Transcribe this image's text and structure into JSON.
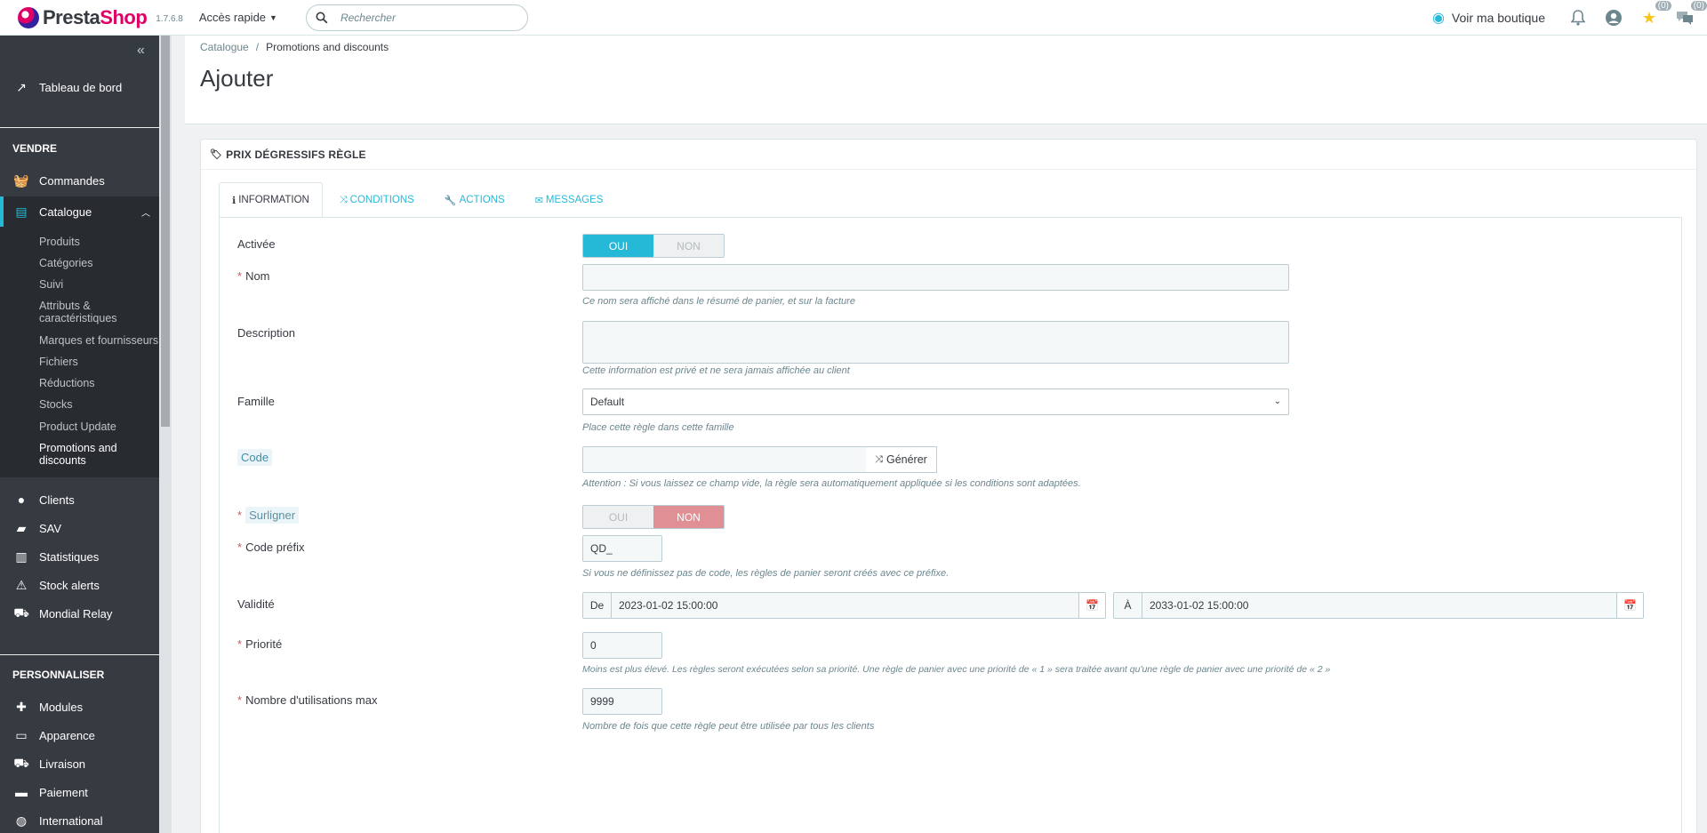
{
  "header": {
    "logo_text_a": "Presta",
    "logo_text_b": "Shop",
    "version": "1.7.6.8",
    "quick_access": "Accès rapide",
    "search_placeholder": "Rechercher",
    "view_shop": "Voir ma boutique",
    "star_count": "(0)",
    "msg_count": "(0)"
  },
  "sidebar": {
    "dashboard": "Tableau de bord",
    "sell_title": "VENDRE",
    "orders": "Commandes",
    "catalog": "Catalogue",
    "catalog_items": [
      "Produits",
      "Catégories",
      "Suivi",
      "Attributs & caractéristiques",
      "Marques et fournisseurs",
      "Fichiers",
      "Réductions",
      "Stocks",
      "Product Update",
      "Promotions and discounts"
    ],
    "customers": "Clients",
    "sav": "SAV",
    "stats": "Statistiques",
    "stock_alerts": "Stock alerts",
    "mondial_relay": "Mondial Relay",
    "customize_title": "PERSONNALISER",
    "modules": "Modules",
    "appearance": "Apparence",
    "shipping": "Livraison",
    "payment": "Paiement",
    "international": "International"
  },
  "breadcrumb": {
    "parent": "Catalogue",
    "current": "Promotions and discounts"
  },
  "page_title": "Ajouter",
  "panel": {
    "title": "PRIX DÉGRESSIFS RÈGLE",
    "tabs": [
      "INFORMATION",
      "CONDITIONS",
      "ACTIONS",
      "MESSAGES"
    ]
  },
  "form": {
    "active_label": "Activée",
    "yes": "OUI",
    "no": "NON",
    "name_label": "Nom",
    "name_help": "Ce nom sera affiché dans le résumé de panier, et sur la facture",
    "desc_label": "Description",
    "desc_help": "Cette information est privé et ne sera jamais affichée au client",
    "family_label": "Famille",
    "family_value": "Default",
    "family_help": "Place cette règle dans cette famille",
    "code_label": "Code",
    "generate": "Générer",
    "code_help": "Attention : Si vous laissez ce champ vide, la règle sera automatiquement appliquée si les conditions sont adaptées.",
    "highlight_label": "Surligner",
    "prefix_label": "Code préfix",
    "prefix_value": "QD_",
    "prefix_help": "Si vous ne définissez pas de code, les règles de panier seront créés avec ce préfixe.",
    "validity_label": "Validité",
    "from_label": "De",
    "from_value": "2023-01-02 15:00:00",
    "to_label": "À",
    "to_value": "2033-01-02 15:00:00",
    "priority_label": "Priorité",
    "priority_value": "0",
    "priority_help": "Moins est plus élevé. Les règles seront exécutées selon sa priorité. Une règle de panier avec une priorité de « 1 » sera traitée avant qu'une règle de panier avec une priorité de « 2 »",
    "max_uses_label": "Nombre d'utilisations max",
    "max_uses_value": "9999",
    "max_uses_help": "Nombre de fois que cette règle peut être utilisée par tous les clients"
  }
}
